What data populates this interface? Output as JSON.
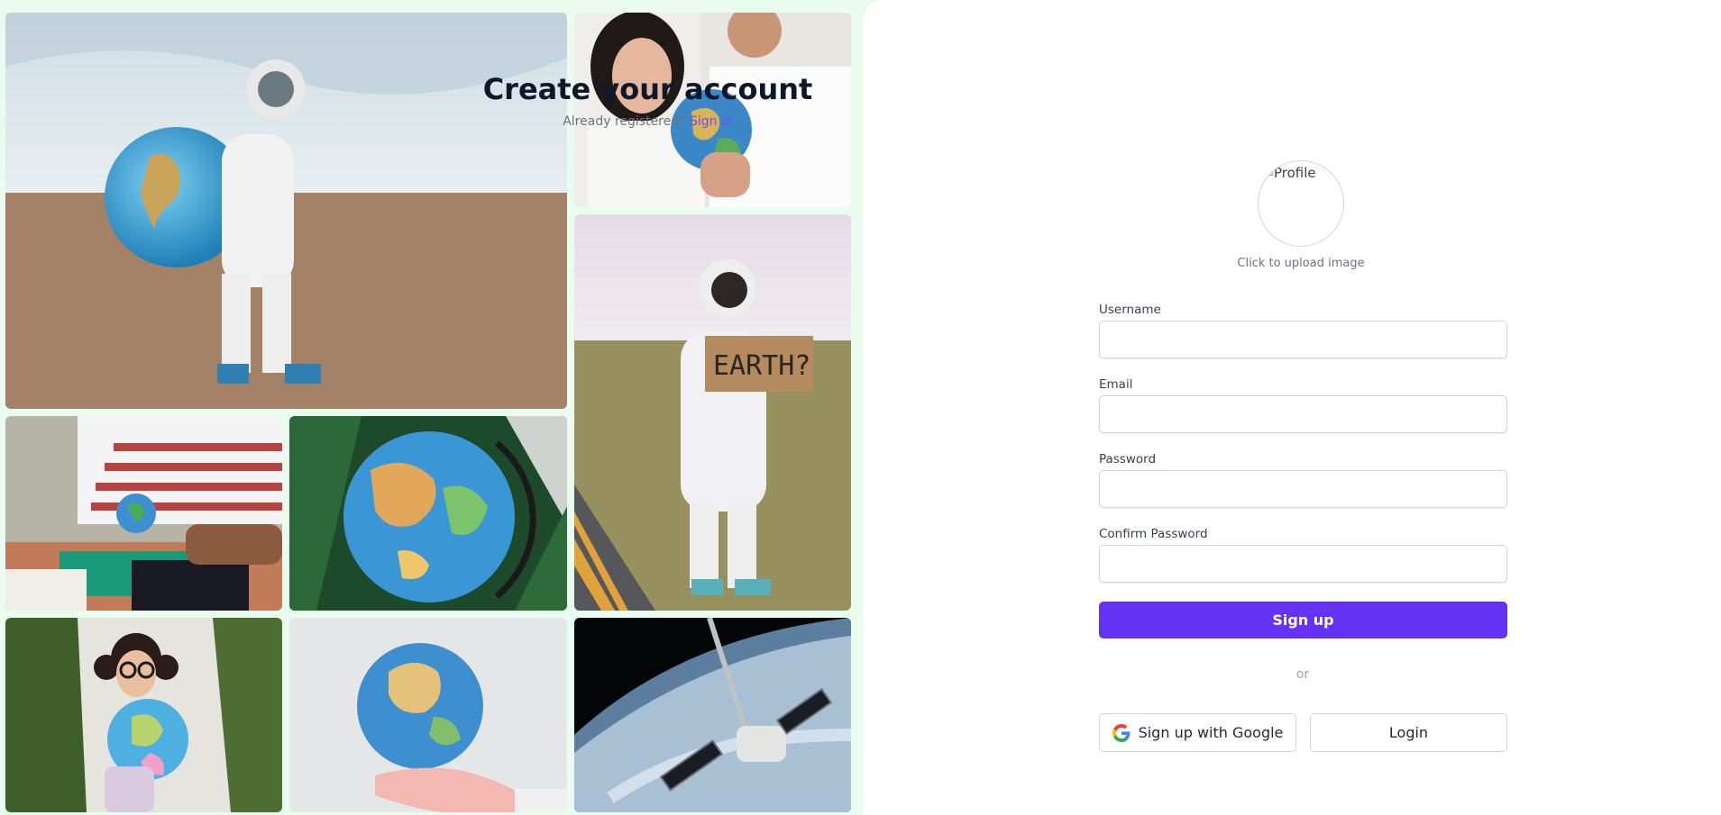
{
  "gallery": {
    "photos": [
      "astronaut-holding-globe-photo",
      "couple-holding-globe-photo",
      "astronaut-with-earth-sign-photo",
      "child-crafting-paper-earth-photo",
      "desk-globe-photo",
      "girl-with-inflatable-globe-photo",
      "hand-holding-globe-photo",
      "spacecraft-over-earth-photo"
    ]
  },
  "form": {
    "title": "Create your account",
    "already_text": "Already registered?",
    "signin_link": "Sign in",
    "avatar_alt": "Profile",
    "upload_hint": "Click to upload image",
    "username_label": "Username",
    "username_value": "",
    "email_label": "Email",
    "email_value": "",
    "password_label": "Password",
    "password_value": "",
    "confirm_label": "Confirm Password",
    "confirm_value": "",
    "signup_label": "Sign up",
    "or_text": "or",
    "google_label": "Sign up with Google",
    "login_label": "Login"
  },
  "colors": {
    "accent": "#6432f2",
    "link": "#6d4bf2",
    "gallery_bg": "#eafbf0"
  },
  "icons": {
    "google": "google-g-icon"
  }
}
